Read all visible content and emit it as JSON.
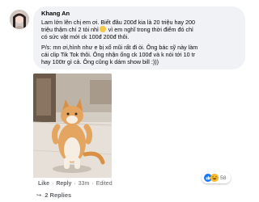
{
  "comment": {
    "author": "Khang An",
    "lines": [
      "Lam lớn lên chị em ơi. Biết đâu 200đ kia là 20 triệu hay 200",
      "triệu thậm chí 2 tỏi nhỉ",
      " vì em nghĩ trong thời điểm đó chỉ",
      "có sức vật mới ck 100đ 200đ thôi.",
      "P/s: mn ơi,hình như e bị xổ mũi rất đi òi. Ông bác sỹ này làm",
      "cái clip Tik Tok thôi. Ông nhận ống ck 100đ và k nói tới 10 tr",
      "hay 100tr gì cả. Ông cũng k dám show bill :)))"
    ],
    "emoji_icon": "grinning-sweat-emoji-icon"
  },
  "photo": {
    "subject": "cat-photo"
  },
  "actions": {
    "like": "Like",
    "reply": "Reply",
    "separator": "·",
    "time": "33m",
    "edited": "Edited"
  },
  "reactions": {
    "count": "58",
    "icons": [
      "like-icon",
      "haha-icon"
    ],
    "like_color": "#1877f2",
    "haha_color": "#f7b928"
  },
  "replies": {
    "label": "2 Replies",
    "arrow_icon": "reply-arrow-icon"
  },
  "colors": {
    "bubble_bg": "#f0f2f5",
    "text": "#050505",
    "secondary_text": "#65676b"
  }
}
